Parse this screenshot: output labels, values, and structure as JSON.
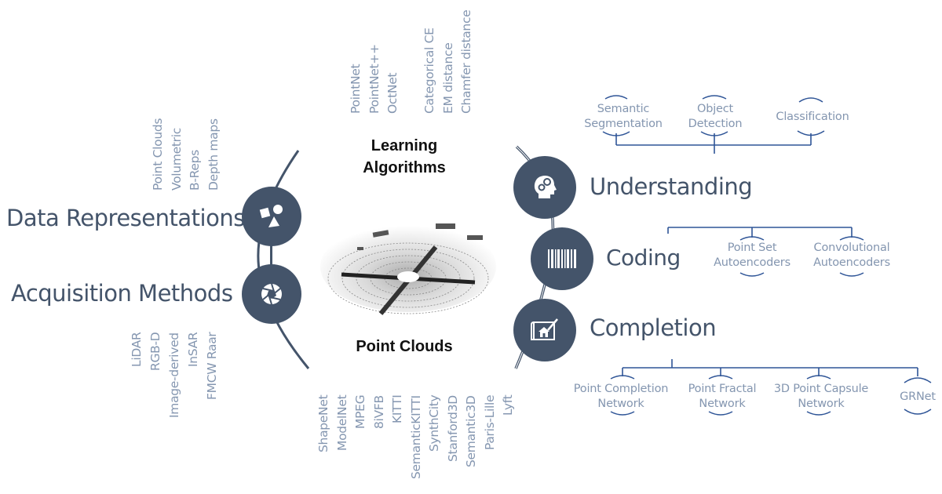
{
  "center": {
    "top_title_line1": "Learning",
    "top_title_line2": "Algorithms",
    "bottom_title": "Point Clouds",
    "image_label": "lidar-point-cloud-scan"
  },
  "left": {
    "data_representations": {
      "label": "Data Representations",
      "icon": "shapes-icon",
      "items": [
        "Point Clouds",
        "Volumetric",
        "B-Reps",
        "Depth maps"
      ]
    },
    "acquisition_methods": {
      "label": "Acquisition Methods",
      "icon": "camera-aperture-icon",
      "items": [
        "LiDAR",
        "RGB-D",
        "Image-derived",
        "InSAR",
        "FMCW Raar"
      ]
    }
  },
  "top": {
    "networks": [
      "PointNet",
      "PointNet++",
      "OctNet"
    ],
    "losses": [
      "Categorical CE",
      "EM distance",
      "Chamfer distance"
    ]
  },
  "bottom": {
    "datasets": [
      "ShapeNet",
      "ModelNet",
      "MPEG",
      "8iVFB",
      "KITTI",
      "SemanticKITTI",
      "SynthCity",
      "Stanford3D",
      "Semantic3D",
      "Paris-Lille",
      "Lyft"
    ]
  },
  "right": {
    "understanding": {
      "label": "Understanding",
      "icon": "head-gears-icon",
      "children": [
        {
          "line1": "Semantic",
          "line2": "Segmentation"
        },
        {
          "line1": "Object",
          "line2": "Detection"
        },
        {
          "line1": "Classification",
          "line2": ""
        }
      ]
    },
    "coding": {
      "label": "Coding",
      "icon": "barcode-icon",
      "children": [
        {
          "line1": "Point Set",
          "line2": "Autoencoders"
        },
        {
          "line1": "Convolutional",
          "line2": "Autoencoders"
        }
      ]
    },
    "completion": {
      "label": "Completion",
      "icon": "blueprint-house-icon",
      "children": [
        {
          "line1": "Point Completion",
          "line2": "Network"
        },
        {
          "line1": "Point Fractal",
          "line2": "Network"
        },
        {
          "line1": "3D Point Capsule",
          "line2": "Network"
        },
        {
          "line1": "GRNet",
          "line2": ""
        }
      ]
    }
  },
  "colors": {
    "node_fill": "#44546a",
    "heading_text": "#44546a",
    "leaf_text": "#8496b0",
    "tree_line": "#2f5597",
    "title_text": "#111111"
  }
}
